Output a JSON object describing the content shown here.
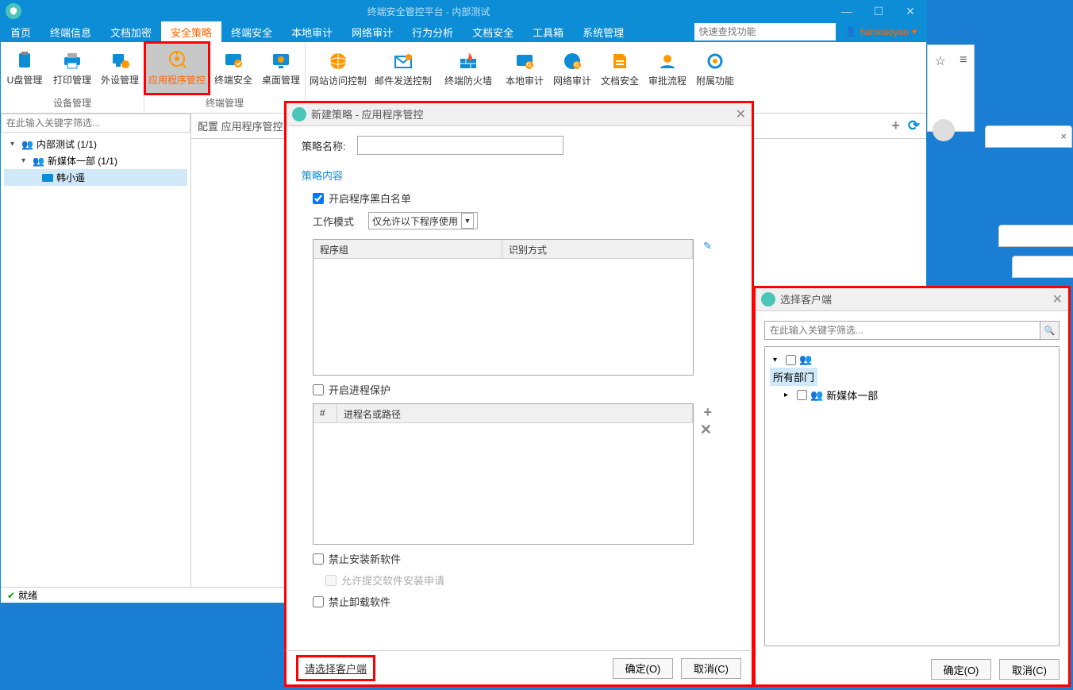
{
  "window": {
    "title": "终端安全管控平台 - 内部测试"
  },
  "menu": {
    "items": [
      "首页",
      "终端信息",
      "文档加密",
      "安全策略",
      "终端安全",
      "本地审计",
      "网络审计",
      "行为分析",
      "文档安全",
      "工具箱",
      "系统管理"
    ],
    "searchPlaceholder": "快速查找功能",
    "user": "hanxiaoyao"
  },
  "ribbon": {
    "group1Label": "设备管理",
    "group2Label": "终端管理",
    "items": [
      {
        "label": "U盘管理"
      },
      {
        "label": "打印管理"
      },
      {
        "label": "外设管理"
      },
      {
        "label": "应用程序管控"
      },
      {
        "label": "终端安全"
      },
      {
        "label": "桌面管理"
      },
      {
        "label": "网站访问控制"
      },
      {
        "label": "邮件发送控制"
      },
      {
        "label": "终端防火墙"
      },
      {
        "label": "本地审计"
      },
      {
        "label": "网络审计"
      },
      {
        "label": "文档安全"
      },
      {
        "label": "审批流程"
      },
      {
        "label": "附属功能"
      }
    ]
  },
  "sidebar": {
    "filterPlaceholder": "在此输入关键字筛选...",
    "root": "内部测试 (1/1)",
    "dept": "新媒体一部 (1/1)",
    "user": "韩小遥"
  },
  "config": {
    "header": "配置 应用程序管控"
  },
  "status": {
    "text": "就绪"
  },
  "dialog1": {
    "title": "新建策略 - 应用程序管控",
    "nameLabel": "策略名称:",
    "sectionTitle": "策略内容",
    "chkBlacklist": "开启程序黑白名单",
    "workModeLabel": "工作模式",
    "workModeValue": "仅允许以下程序使用",
    "col1": "程序组",
    "col2": "识别方式",
    "chkProcessProtect": "开启进程保护",
    "colHash": "#",
    "colProcess": "进程名或路径",
    "chkNoInstall": "禁止安装新软件",
    "chkSubmitReq": "允许提交软件安装申请",
    "chkNoUninstall": "禁止卸载软件",
    "selectClient": "请选择客户端",
    "ok": "确定(O)",
    "cancel": "取消(C)"
  },
  "dialog2": {
    "title": "选择客户端",
    "searchPlaceholder": "在此输入关键字筛选...",
    "root": "所有部门",
    "dept": "新媒体一部",
    "ok": "确定(O)",
    "cancel": "取消(C)"
  }
}
